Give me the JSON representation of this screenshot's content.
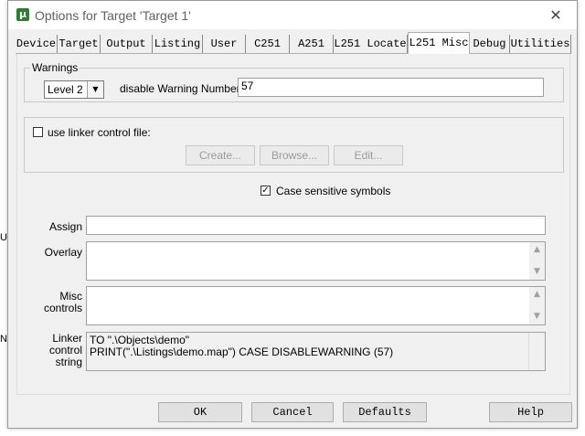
{
  "background_fragments": [
    "U",
    "N"
  ],
  "window": {
    "title": "Options for Target 'Target 1'",
    "app_icon": "µ",
    "close_glyph": "✕"
  },
  "tabs": [
    {
      "label": "Device"
    },
    {
      "label": "Target"
    },
    {
      "label": "Output"
    },
    {
      "label": "Listing"
    },
    {
      "label": "User"
    },
    {
      "label": "C251"
    },
    {
      "label": "A251"
    },
    {
      "label": "L251 Locate"
    },
    {
      "label": "L251 Misc",
      "active": true
    },
    {
      "label": "Debug"
    },
    {
      "label": "Utilities"
    }
  ],
  "warnings": {
    "group_label": "Warnings",
    "level_value": "Level 2",
    "disable_label": "disable Warning Numbers:",
    "disable_value": "57"
  },
  "linker_file": {
    "checkbox_label": "use linker control file:",
    "checked": false,
    "create_label": "Create...",
    "browse_label": "Browse...",
    "edit_label": "Edit..."
  },
  "case_sensitive": {
    "label": "Case sensitive symbols",
    "checked": true,
    "check_glyph": "✓"
  },
  "fields": {
    "assign_label": "Assign",
    "assign_value": "",
    "overlay_label": "Overlay",
    "overlay_value": "",
    "misc_label_line1": "Misc",
    "misc_label_line2": "controls",
    "misc_value": "",
    "linker_label_line1": "Linker",
    "linker_label_line2": "control",
    "linker_label_line3": "string",
    "linker_value_line1": "TO \".\\Objects\\demo\"",
    "linker_value_line2": "PRINT(\".\\Listings\\demo.map\") CASE DISABLEWARNING (57)"
  },
  "buttons": {
    "ok": "OK",
    "cancel": "Cancel",
    "defaults": "Defaults",
    "help": "Help"
  },
  "glyphs": {
    "dropdown": "▼",
    "scroll_up": "▲",
    "scroll_down": "▼"
  }
}
